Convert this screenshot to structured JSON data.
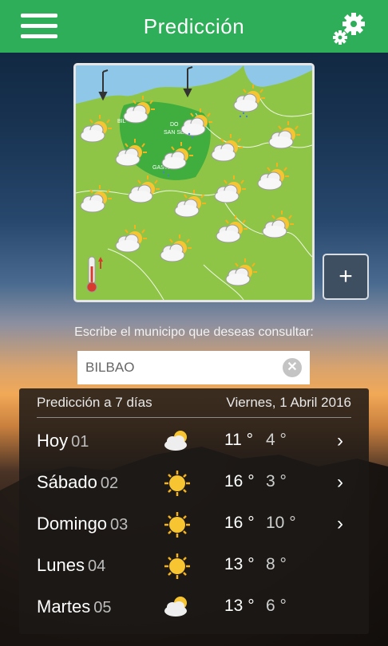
{
  "header": {
    "title": "Predicción",
    "menu_icon": "hamburger-menu-icon",
    "settings_icon": "gears-icon"
  },
  "map": {
    "expand_label": "+"
  },
  "search": {
    "label": "Escribe el municipo que deseas consultar:",
    "value": "BILBAO",
    "clear_label": "✕"
  },
  "forecast": {
    "header_left": "Predicción a 7 días",
    "header_right": "Viernes, 1 Abril 2016",
    "days": [
      {
        "name": "Hoy",
        "num": "01",
        "icon": "cloud-sun-icon",
        "max": "11 °",
        "min": "4 °",
        "has_detail": true
      },
      {
        "name": "Sábado",
        "num": "02",
        "icon": "sun-icon",
        "max": "16 °",
        "min": "3 °",
        "has_detail": true
      },
      {
        "name": "Domingo",
        "num": "03",
        "icon": "sun-icon",
        "max": "16 °",
        "min": "10 °",
        "has_detail": true
      },
      {
        "name": "Lunes",
        "num": "04",
        "icon": "sun-icon",
        "max": "13 °",
        "min": "8 °",
        "has_detail": false
      },
      {
        "name": "Martes",
        "num": "05",
        "icon": "cloud-sun-icon",
        "max": "13 °",
        "min": "6 °",
        "has_detail": false
      }
    ],
    "chevron": "›"
  }
}
